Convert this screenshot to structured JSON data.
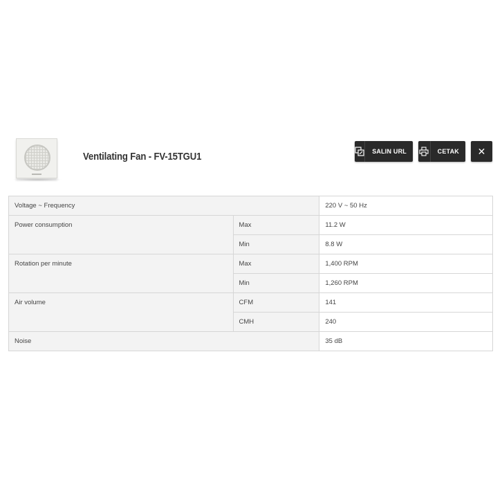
{
  "product": {
    "title": "Ventilating Fan - FV-15TGU1",
    "thumbnail_icon": "product-thumbnail"
  },
  "actions": {
    "copy_url": {
      "label": "SALIN URL",
      "icon": "copy-link-icon"
    },
    "print": {
      "label": "CETAK",
      "icon": "printer-icon"
    },
    "close": {
      "label": "✕",
      "icon": "close-icon"
    }
  },
  "specs": {
    "voltage": {
      "name": "Voltage ~ Frequency",
      "value": "220 V ~ 50 Hz"
    },
    "power": {
      "name": "Power consumption",
      "rows": [
        {
          "sub": "Max",
          "value": "11.2 W"
        },
        {
          "sub": "Min",
          "value": "8.8 W"
        }
      ]
    },
    "rpm": {
      "name": "Rotation per minute",
      "rows": [
        {
          "sub": "Max",
          "value": "1,400 RPM"
        },
        {
          "sub": "Min",
          "value": "1,260 RPM"
        }
      ]
    },
    "air": {
      "name": "Air volume",
      "rows": [
        {
          "sub": "CFM",
          "value": "141"
        },
        {
          "sub": "CMH",
          "value": "240"
        }
      ]
    },
    "noise": {
      "name": "Noise",
      "value": "35 dB"
    }
  }
}
